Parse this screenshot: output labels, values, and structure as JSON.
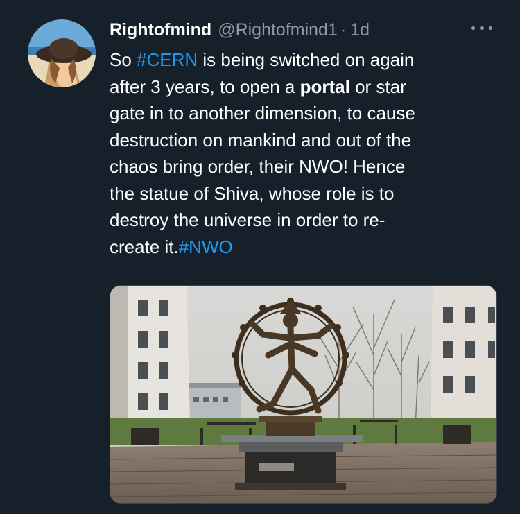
{
  "tweet": {
    "display_name": "Rightofmind",
    "handle": "@Rightofmind1",
    "separator": "·",
    "time": "1d",
    "more_icon": "more-horizontal-icon",
    "lines": [
      [
        {
          "t": "So "
        },
        {
          "t": "#CERN",
          "tag": true
        },
        {
          "t": " is being switched on again"
        }
      ],
      [
        {
          "t": "after 3 years, to open a "
        },
        {
          "t": "portal",
          "bold": true
        },
        {
          "t": " or star"
        }
      ],
      [
        {
          "t": "gate in to another dimension, to cause"
        }
      ],
      [
        {
          "t": "destruction on mankind and out of the"
        }
      ],
      [
        {
          "t": "chaos bring order, their NWO! Hence"
        }
      ],
      [
        {
          "t": "the statue of Shiva, whose role is to"
        }
      ],
      [
        {
          "t": "destroy the universe in order to re-"
        }
      ],
      [
        {
          "t": "create it."
        },
        {
          "t": "#NWO",
          "tag": true
        }
      ]
    ]
  },
  "colors": {
    "background": "#15202b",
    "text": "#ffffff",
    "secondary": "#8b98a5",
    "link": "#1d9bf0"
  }
}
